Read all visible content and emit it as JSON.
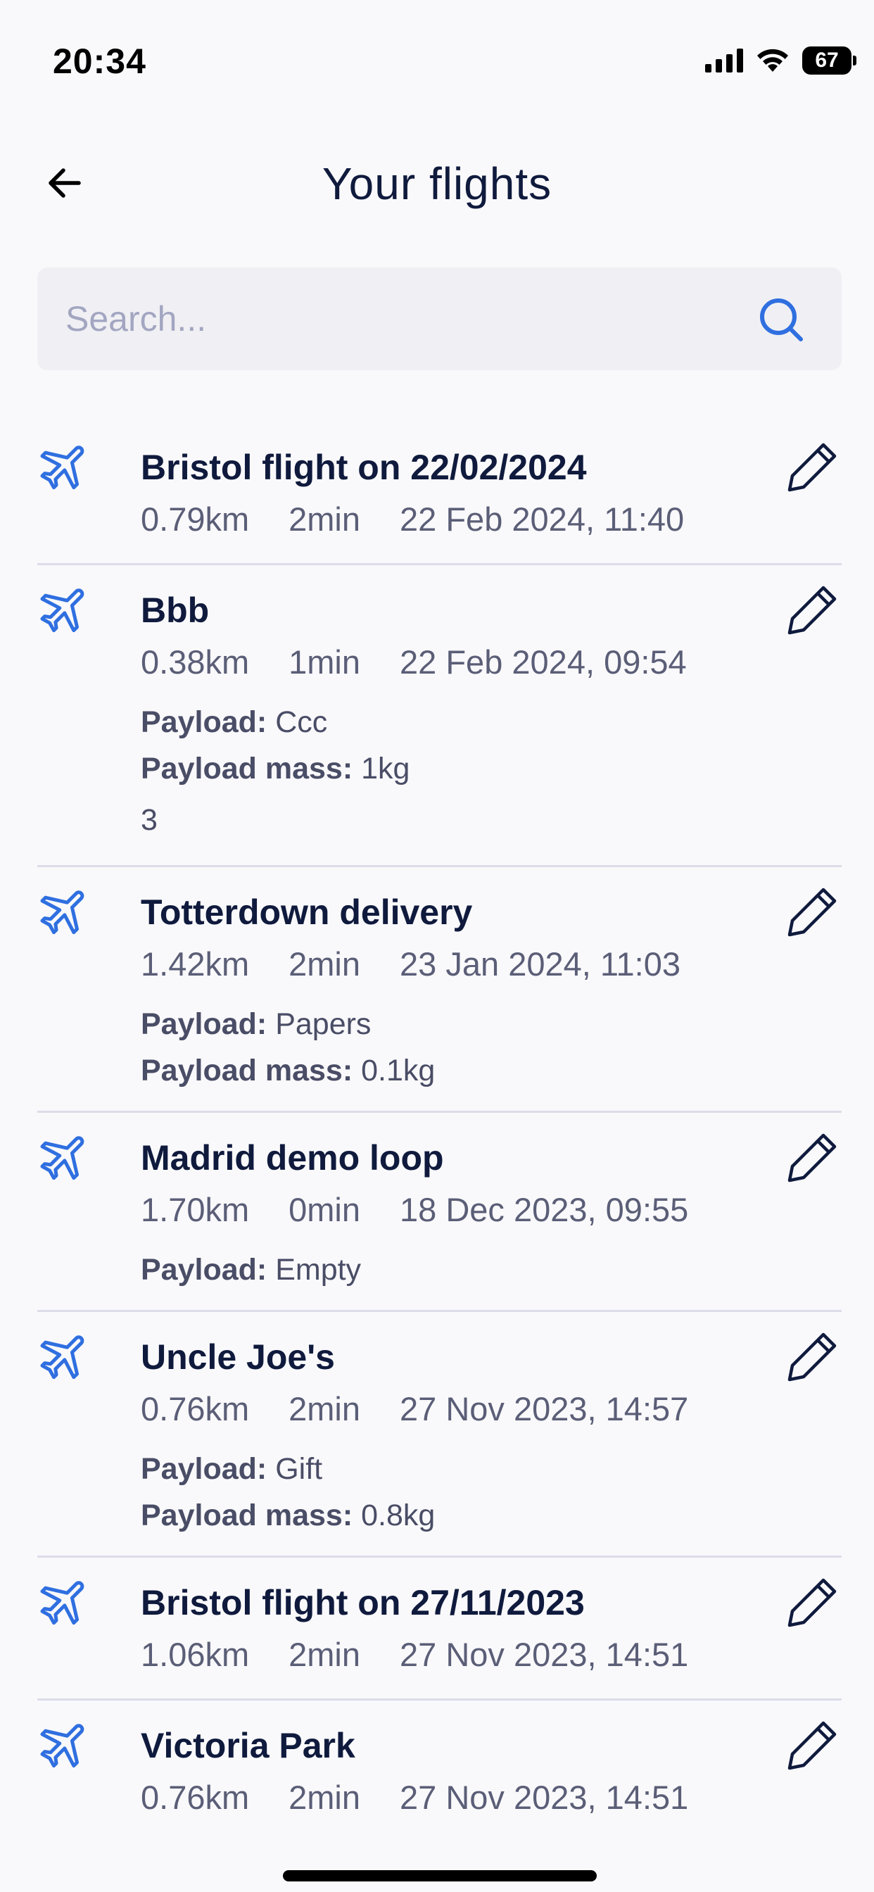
{
  "status_bar": {
    "time": "20:34",
    "battery": "67",
    "icons": [
      "cellular-signal-icon",
      "wifi-icon",
      "battery-icon"
    ]
  },
  "header": {
    "title": "Your flights",
    "back_icon": "arrow-left-icon"
  },
  "search": {
    "placeholder": "Search...",
    "value": "",
    "icon": "search-icon"
  },
  "colors": {
    "accent": "#2f6fe0",
    "text_primary": "#0f1a3d",
    "text_secondary": "#5b5e77",
    "background": "#f9f9fb",
    "search_bg": "#f0f0f4",
    "divider": "#dcdde8"
  },
  "labels": {
    "payload": "Payload:",
    "payload_mass": "Payload mass:"
  },
  "flights": [
    {
      "name": "Bristol flight on 22/02/2024",
      "distance": "0.79km",
      "duration": "2min",
      "date": "22 Feb 2024, 11:40"
    },
    {
      "name": "Bbb",
      "distance": "0.38km",
      "duration": "1min",
      "date": "22 Feb 2024, 09:54",
      "payload": "Ccc",
      "payload_mass": "1kg",
      "note": "3"
    },
    {
      "name": "Totterdown delivery",
      "distance": "1.42km",
      "duration": "2min",
      "date": "23 Jan 2024, 11:03",
      "payload": "Papers",
      "payload_mass": "0.1kg"
    },
    {
      "name": "Madrid demo loop",
      "distance": "1.70km",
      "duration": "0min",
      "date": "18 Dec 2023, 09:55",
      "payload": "Empty"
    },
    {
      "name": "Uncle Joe's",
      "distance": "0.76km",
      "duration": "2min",
      "date": "27 Nov 2023, 14:57",
      "payload": "Gift",
      "payload_mass": "0.8kg"
    },
    {
      "name": "Bristol flight on 27/11/2023",
      "distance": "1.06km",
      "duration": "2min",
      "date": "27 Nov 2023, 14:51"
    },
    {
      "name": "Victoria Park",
      "distance": "0.76km",
      "duration": "2min",
      "date": "27 Nov 2023, 14:51"
    }
  ]
}
